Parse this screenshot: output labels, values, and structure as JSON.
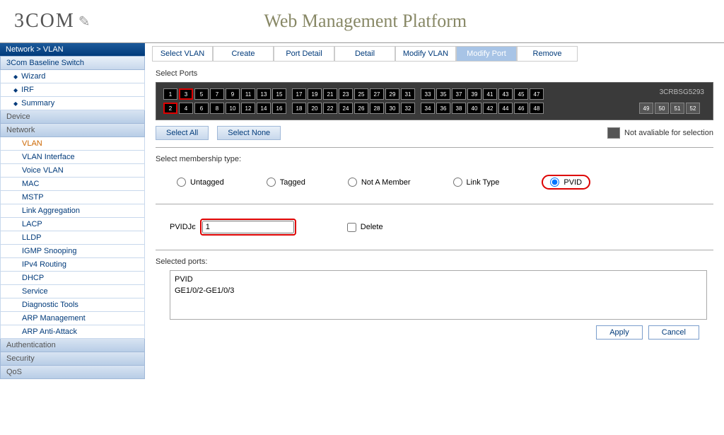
{
  "header": {
    "logo_text": "3COM",
    "platform_title": "Web Management Platform"
  },
  "breadcrumb": "Network > VLAN",
  "sidebar": {
    "top_section": "3Com Baseline Switch",
    "top_items": [
      {
        "label": "Wizard"
      },
      {
        "label": "IRF"
      },
      {
        "label": "Summary"
      }
    ],
    "groups": [
      {
        "label": "Device",
        "items": []
      },
      {
        "label": "Network",
        "items": [
          {
            "label": "VLAN",
            "active": true
          },
          {
            "label": "VLAN Interface"
          },
          {
            "label": "Voice VLAN"
          },
          {
            "label": "MAC"
          },
          {
            "label": "MSTP"
          },
          {
            "label": "Link Aggregation"
          },
          {
            "label": "LACP"
          },
          {
            "label": "LLDP"
          },
          {
            "label": "IGMP Snooping"
          },
          {
            "label": "IPv4 Routing"
          },
          {
            "label": "DHCP"
          },
          {
            "label": "Service"
          },
          {
            "label": "Diagnostic Tools"
          },
          {
            "label": "ARP Management"
          },
          {
            "label": "ARP Anti-Attack"
          }
        ]
      },
      {
        "label": "Authentication",
        "items": []
      },
      {
        "label": "Security",
        "items": []
      },
      {
        "label": "QoS",
        "items": []
      }
    ]
  },
  "tabs": [
    {
      "label": "Select VLAN"
    },
    {
      "label": "Create"
    },
    {
      "label": "Port Detail"
    },
    {
      "label": "Detail"
    },
    {
      "label": "Modify VLAN"
    },
    {
      "label": "Modify Port",
      "active": true
    },
    {
      "label": "Remove"
    }
  ],
  "select_ports_label": "Select Ports",
  "switch_model": "3CRBSG5293",
  "ports_top": [
    "1",
    "3",
    "5",
    "7",
    "9",
    "11",
    "13",
    "15",
    "17",
    "19",
    "21",
    "23",
    "25",
    "27",
    "29",
    "31",
    "33",
    "35",
    "37",
    "39",
    "41",
    "43",
    "45",
    "47"
  ],
  "ports_bottom": [
    "2",
    "4",
    "6",
    "8",
    "10",
    "12",
    "14",
    "16",
    "18",
    "20",
    "22",
    "24",
    "26",
    "28",
    "30",
    "32",
    "34",
    "36",
    "38",
    "40",
    "42",
    "44",
    "46",
    "48"
  ],
  "ports_extra": [
    "49",
    "50",
    "51",
    "52"
  ],
  "selected_ports_numbers": [
    "2",
    "3"
  ],
  "buttons": {
    "select_all": "Select All",
    "select_none": "Select None"
  },
  "legend_text": "Not avaliable for selection",
  "membership_label": "Select membership type:",
  "membership": {
    "untagged": "Untagged",
    "tagged": "Tagged",
    "not_member": "Not A Member",
    "link_type": "Link Type",
    "pvid": "PVID",
    "selected": "pvid"
  },
  "pvid_label": "PVIDЈє",
  "pvid_value": "1",
  "delete_label": "Delete",
  "selected_ports_label": "Selected ports:",
  "selected_ports_header": "PVID",
  "selected_ports_value": "GE1/0/2-GE1/0/3",
  "footer": {
    "apply": "Apply",
    "cancel": "Cancel"
  }
}
